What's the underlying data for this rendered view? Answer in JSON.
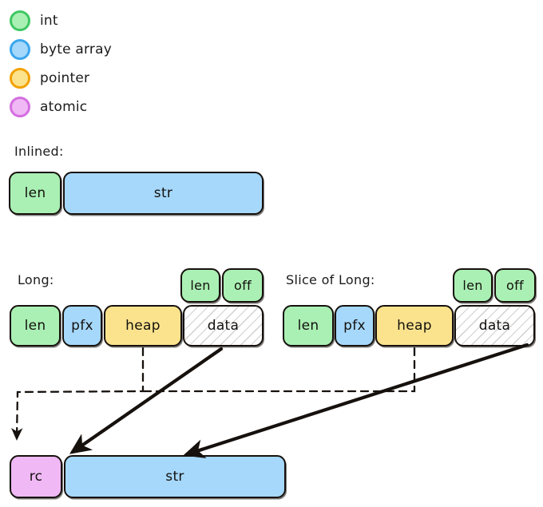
{
  "legend": {
    "items": [
      {
        "label": "int",
        "fill": "#aaf0b4",
        "stroke": "#3fc763"
      },
      {
        "label": "byte array",
        "fill": "#a6d8fb",
        "stroke": "#3aa6ee"
      },
      {
        "label": "pointer",
        "fill": "#fbe38d",
        "stroke": "#f2a101"
      },
      {
        "label": "atomic",
        "fill": "#f0b8f5",
        "stroke": "#d46ee0"
      }
    ]
  },
  "sections": {
    "inlined": {
      "caption": "Inlined:",
      "fields": [
        {
          "label": "len",
          "kind": "int"
        },
        {
          "label": "str",
          "kind": "byte array"
        }
      ]
    },
    "long": {
      "caption": "Long:",
      "fields": [
        {
          "label": "len",
          "kind": "int"
        },
        {
          "label": "pfx",
          "kind": "byte array"
        },
        {
          "label": "heap",
          "kind": "pointer"
        },
        {
          "label": "data",
          "kind": "hatched"
        }
      ],
      "data_parts": [
        {
          "label": "len",
          "kind": "int"
        },
        {
          "label": "off",
          "kind": "int"
        }
      ]
    },
    "slice_of_long": {
      "caption": "Slice of Long:",
      "fields": [
        {
          "label": "len",
          "kind": "int"
        },
        {
          "label": "pfx",
          "kind": "byte array"
        },
        {
          "label": "heap",
          "kind": "pointer"
        },
        {
          "label": "data",
          "kind": "hatched"
        }
      ],
      "data_parts": [
        {
          "label": "len",
          "kind": "int"
        },
        {
          "label": "off",
          "kind": "int"
        }
      ]
    },
    "heap_allocation": {
      "fields": [
        {
          "label": "rc",
          "kind": "atomic"
        },
        {
          "label": "str",
          "kind": "byte array"
        }
      ]
    }
  },
  "colors": {
    "int": "#aaf0b4",
    "byte_array": "#a6d8fb",
    "pointer": "#fbe38d",
    "atomic": "#f0b8f5",
    "hatched": "#ffffff",
    "outline": "#16110d",
    "text": "#13100d",
    "background": "#ffffff"
  }
}
